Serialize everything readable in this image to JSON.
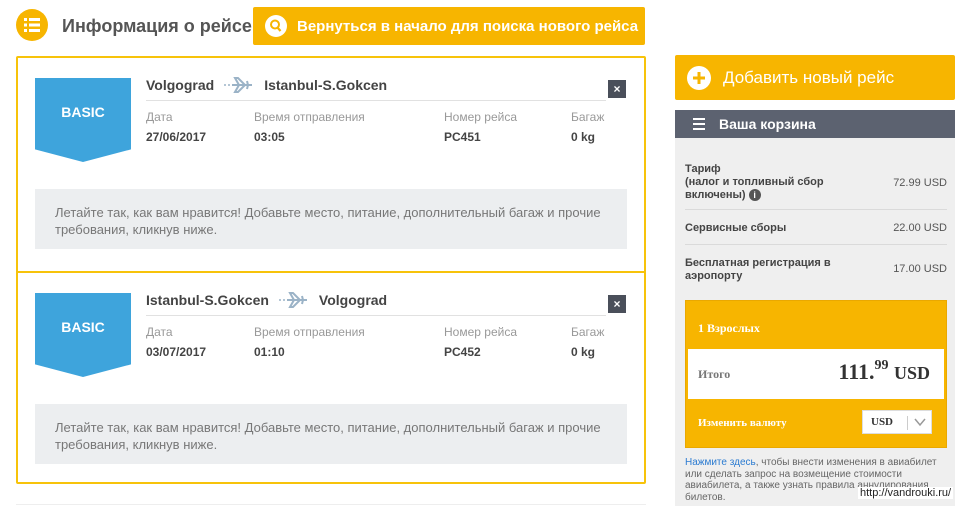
{
  "header": {
    "title": "Информация о рейсе",
    "back_button": "Вернуться в начало для поиска нового рейса",
    "icon": "list-icon"
  },
  "flights": [
    {
      "fare": "BASIC",
      "from": "Volgograd",
      "to": "Istanbul-S.Gokcen",
      "labels": {
        "date": "Дата",
        "time": "Время отправления",
        "flight": "Номер рейса",
        "baggage": "Багаж"
      },
      "date": "27/06/2017",
      "time": "03:05",
      "flight_no": "PC451",
      "baggage": "0 kg",
      "promo": "Летайте так, как вам нравится! Добавьте место, питание, дополнительный багаж и прочие требования, кликнув ниже.",
      "close": "×"
    },
    {
      "fare": "BASIC",
      "from": "Istanbul-S.Gokcen",
      "to": "Volgograd",
      "labels": {
        "date": "Дата",
        "time": "Время отправления",
        "flight": "Номер рейса",
        "baggage": "Багаж"
      },
      "date": "03/07/2017",
      "time": "01:10",
      "flight_no": "PC452",
      "baggage": "0 kg",
      "promo": "Летайте так, как вам нравится! Добавьте место, питание, дополнительный багаж и прочие требования, кликнув ниже.",
      "close": "×"
    }
  ],
  "sidebar": {
    "add_flight": "Добавить новый рейс",
    "cart_title": "Ваша корзина",
    "rows": [
      {
        "label": "Тариф\n(налог и топливный сбор включены)",
        "label_main": "Тариф",
        "label_sub": "(налог и топливный сбор включены)",
        "amount": "72.99 USD"
      },
      {
        "label": "Сервисные сборы",
        "amount": "22.00 USD"
      },
      {
        "label": "Бесплатная регистрация в аэропорту",
        "amount": "17.00 USD"
      }
    ],
    "passengers": "1 Взрослых",
    "total_label": "Итого",
    "total_int": "111.",
    "total_dec": "99",
    "total_currency": "USD",
    "currency_label": "Изменить валюту",
    "currency_value": "USD",
    "note_link": "Нажмите здесь",
    "note_text": ", чтобы внести изменения в авиабилет или сделать запрос на возмещение стоимости авиабилета, а также узнать правила аннулирования билетов."
  },
  "watermark": "http://vandrouki.ru/",
  "colors": {
    "accent": "#f7b500",
    "badge": "#3ea4dc",
    "dark": "#5c6270"
  }
}
